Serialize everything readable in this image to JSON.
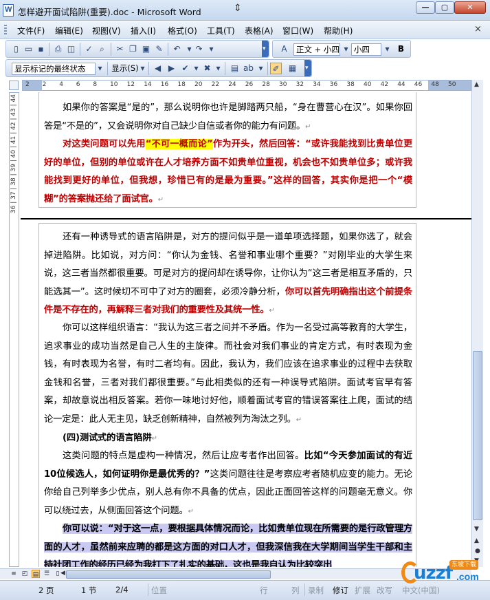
{
  "window": {
    "title": "怎样避开面试陷阱(重要).doc - Microsoft Word",
    "min": "—",
    "max": "▢",
    "close": "✕"
  },
  "menu": [
    "文件(F)",
    "编辑(E)",
    "视图(V)",
    "插入(I)",
    "格式(O)",
    "工具(T)",
    "表格(A)",
    "窗口(W)",
    "帮助(H)"
  ],
  "menu_close": "×",
  "toolbar": {
    "style_value": "正文 + 小四",
    "size_value": "小四",
    "bold_label": "B",
    "markup_value": "显示标记的最终状态",
    "show_label": "显示(S)"
  },
  "ruler": {
    "h_numbers": [
      "2",
      "2",
      "4",
      "6",
      "8",
      "10",
      "12",
      "14",
      "16",
      "18",
      "20",
      "22",
      "24",
      "26",
      "28",
      "30",
      "32",
      "34",
      "36",
      "38",
      "40",
      "42",
      "44",
      "46",
      "48",
      "50"
    ],
    "v_numbers": "36 | 37 | 38 | 39 | 40 | 41 | 42 | 43 | 44"
  },
  "document": {
    "p1": "如果你的答案是“是的”，那么说明你也许是脚踏两只船，“身在曹营心在汉”。如果你回答是“不是的”，又会说明你对自己缺少自信或者你的能力有问题。",
    "p2_a": "对这类问题可以先用",
    "p2_hl": "“不可一概而论”",
    "p2_b": "作为开头，然后回答：“或许我能找到比贵单位更好的单位，但别的单位或许在人才培养方面不如贵单位重视，机会也不如贵单位多；或许我能找到更好的单位，但我想，珍惜已有的是最为重要。”这样的回答，其实你是把一个“模糊”的答案抛还给了面试官。",
    "p3_a": "还有一种诱导式的语言陷阱是，对方的提问似乎是一道单项选择题，如果你选了，就会掉进陷阱。比如说，对方问：“你认为金钱、名誉和事业哪个重要？”对刚毕业的大学生来说，这三者当然都很重要。可是对方的提问却在诱导你，让你认为“这三者是相互矛盾的，只能选其一”。这时候切不可中了对方的圈套，必须冷静分析，",
    "p3_b": "你可以首先明确指出这个前提条件是不存在的，再解释三者对我们的重要性及其统一性。",
    "p4": "你可以这样组织语言：“我认为这三者之间并不矛盾。作为一名受过高等教育的大学生，追求事业的成功当然是自己人生的主旋律。而社会对我们事业的肯定方式，有时表现为金钱，有时表现为名誉，有时二者均有。因此，我认为，我们应该在追求事业的过程中去获取金钱和名誉，三者对我们都很重要。”与此相类似的还有一种误导式陷阱。面试考官早有答案，却故意说出相反答案。若你一味地讨好他，顺着面试考官的错误答案往上爬，面试的结论一定是：此人无主见，缺乏创新精神，自然被列为淘汰之列。",
    "heading": "(四)测试式的语言陷阱",
    "p5_a": "这类问题的特点是虚构一种情况，然后让应考者作出回答。",
    "p5_b": "比如“今天参加面试的有近10位候选人，如何证明你是最优秀的？”",
    "p5_c": "这类问题往往是考察应考者随机应变的能力。无论你给自己列举多少优点，别人总有你不具备的优点，因此正面回答这样的问题毫无意义。你可以绕过去，从侧面回答这个问题。",
    "p6": "你可以说：“对于这一点，要根据具体情况而论，比如贵单位现在所需要的是行政管理方面的人才，虽然前来应聘的都是这方面的对口人才，但我深信我在大学期间当学生干部和主持社团工作的经历已经为我打下了扎实的基础，这也是我自认为比较突出",
    "mark": "↵"
  },
  "status": {
    "page": "2 页",
    "section": "1 节",
    "pages": "2/4",
    "position": "位置",
    "line": "行",
    "col": "列",
    "rec": "录制",
    "trk": "修订",
    "ext": "扩展",
    "ovr": "改写",
    "lang": "中文(中国)"
  },
  "watermark": {
    "logo": "uzzf",
    "badge": "东坡下载",
    "domain": ".com"
  }
}
